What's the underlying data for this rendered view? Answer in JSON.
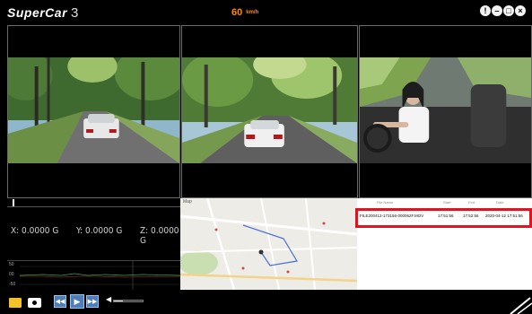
{
  "app": {
    "name": "SuperCar",
    "version": "3",
    "speed": "60",
    "speed_unit": "km/h"
  },
  "window_buttons": [
    "!",
    "–",
    "□",
    "×"
  ],
  "gsensor": {
    "x": "X: 0.0000 G",
    "y": "Y: 0.0000 G",
    "z": "Z: 0.0000 G"
  },
  "graph_ticks": [
    "50",
    "00",
    "-50"
  ],
  "map": {
    "label": "Map"
  },
  "file_list": {
    "headers": [
      "File Name",
      "Start",
      "End",
      "Date"
    ],
    "rows": [
      {
        "name": "FILE200412-173156-000062F.MOV",
        "start": "17:51:56",
        "end": "17:52:56",
        "date": "2020-04-12 17:51:56"
      }
    ]
  },
  "controls": {
    "volume_level": 0.3,
    "icons": [
      "folder-icon",
      "camera-icon",
      "rewind-icon",
      "play-icon",
      "fast-forward-icon",
      "volume-icon"
    ]
  },
  "colors": {
    "accent_speed": "#ff8a00",
    "highlight": "#e5121d",
    "button_blue": "#4f7db8"
  }
}
